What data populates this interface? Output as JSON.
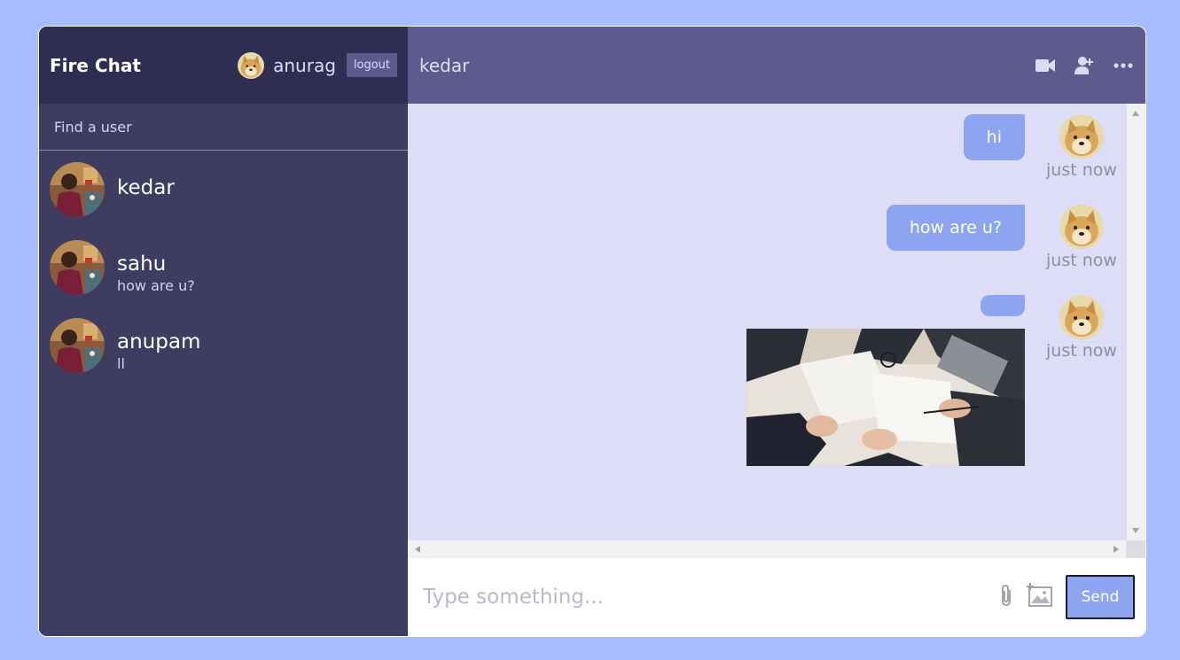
{
  "sidebar": {
    "brand": "Fire Chat",
    "current_user": {
      "name": "anurag",
      "avatar": "doge-avatar"
    },
    "logout_label": "logout",
    "search_placeholder": "Find a user",
    "chats": [
      {
        "name": "kedar",
        "last_message": "",
        "avatar": "person-avatar"
      },
      {
        "name": "sahu",
        "last_message": "how are u?",
        "avatar": "person-avatar"
      },
      {
        "name": "anupam",
        "last_message": "ll",
        "avatar": "person-avatar"
      }
    ]
  },
  "chat": {
    "title": "kedar",
    "icons": [
      "video-camera-icon",
      "add-user-icon",
      "more-icon"
    ],
    "messages": [
      {
        "text": "hi",
        "time": "just now",
        "owner": true,
        "avatar": "doge-avatar"
      },
      {
        "text": "how are u?",
        "time": "just now",
        "owner": true,
        "avatar": "doge-avatar"
      },
      {
        "text": "",
        "time": "just now",
        "owner": true,
        "avatar": "doge-avatar",
        "image": "business-meeting-photo"
      }
    ],
    "input_placeholder": "Type something...",
    "attach_icon": "paperclip-icon",
    "image_icon": "add-image-icon",
    "send_label": "Send"
  },
  "colors": {
    "background": "#a7bcff",
    "sidebar": "#3e3c61",
    "sidebar_header": "#2f2d52",
    "chat_header": "#5d5b8d",
    "messages_bg": "#ddddf7",
    "bubble": "#8da4f1"
  }
}
